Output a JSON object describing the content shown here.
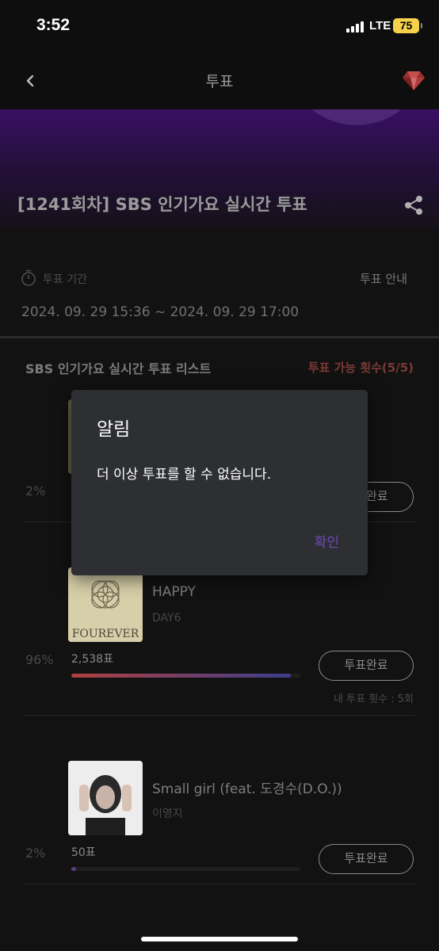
{
  "status_bar": {
    "time": "3:52",
    "network": "LTE",
    "battery": "75"
  },
  "nav": {
    "title": "투표"
  },
  "banner": {
    "title": "[1241회차] SBS 인기가요 실시간 투표"
  },
  "period": {
    "label": "투표 기간",
    "guide": "투표 안내",
    "range": "2024. 09. 29 15:36 ~ 2024. 09. 29 17:00"
  },
  "list": {
    "title": "SBS 인기가요 실시간 투표 리스트",
    "count": "투표 가능 횟수(5/5)"
  },
  "items": [
    {
      "percent": "2%",
      "button": "투표완료"
    },
    {
      "title": "HAPPY",
      "artist": "DAY6",
      "album_art_text": "FOUREVER",
      "percent": "96%",
      "votes": "2,538표",
      "share": 0.96,
      "button": "투표완료",
      "my_votes": "내 투표 횟수 : 5회"
    },
    {
      "title": "Small girl (feat. 도경수(D.O.))",
      "artist": "이영지",
      "percent": "2%",
      "votes": "50표",
      "share": 0.02,
      "button": "투표완료"
    }
  ],
  "dialog": {
    "title": "알림",
    "message": "더 이상 투표를 할 수 없습니다.",
    "confirm": "확인"
  },
  "colors": {
    "accent": "#6c4ab6",
    "bar_start": "#b04040",
    "bar_end": "#3d3d8a",
    "banner_purple": "#3a0f63"
  }
}
